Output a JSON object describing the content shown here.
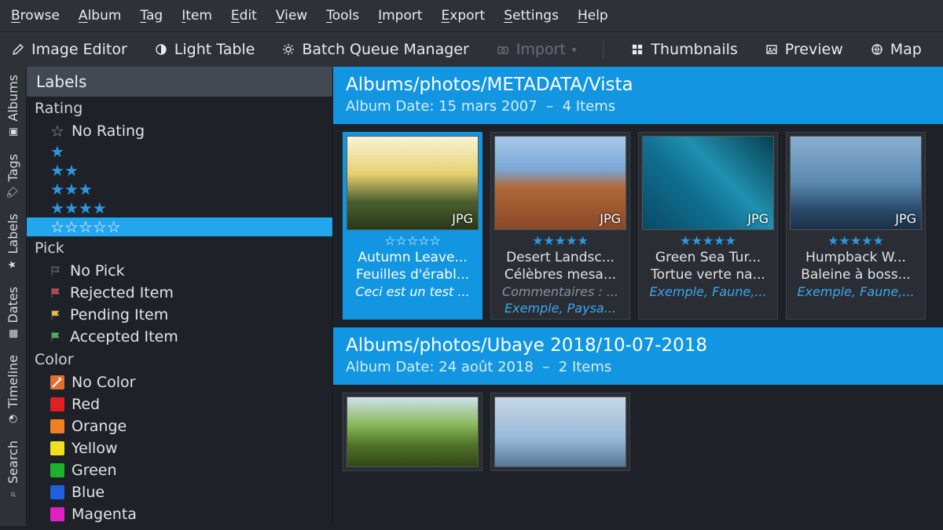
{
  "menu": [
    "Browse",
    "Album",
    "Tag",
    "Item",
    "Edit",
    "View",
    "Tools",
    "Import",
    "Export",
    "Settings",
    "Help"
  ],
  "toolbar": {
    "image_editor": "Image Editor",
    "light_table": "Light Table",
    "batch": "Batch Queue Manager",
    "import": "Import",
    "thumbnails": "Thumbnails",
    "preview": "Preview",
    "map": "Map"
  },
  "rail": [
    "Albums",
    "Tags",
    "Labels",
    "Dates",
    "Timeline",
    "Search"
  ],
  "sidebar": {
    "header": "Labels",
    "rating_label": "Rating",
    "no_rating": "No Rating",
    "selected_stars": 5,
    "pick_label": "Pick",
    "picks": [
      {
        "label": "No Pick",
        "color": "#2a2e34"
      },
      {
        "label": "Rejected Item",
        "color": "#e03040"
      },
      {
        "label": "Pending Item",
        "color": "#f0c030"
      },
      {
        "label": "Accepted Item",
        "color": "#30c050"
      }
    ],
    "color_label": "Color",
    "colors": [
      {
        "label": "No Color",
        "swatch": "#e07030",
        "icon": true
      },
      {
        "label": "Red",
        "swatch": "#e02020"
      },
      {
        "label": "Orange",
        "swatch": "#f08020"
      },
      {
        "label": "Yellow",
        "swatch": "#f0e020"
      },
      {
        "label": "Green",
        "swatch": "#20b030"
      },
      {
        "label": "Blue",
        "swatch": "#2060e0"
      },
      {
        "label": "Magenta",
        "swatch": "#e020c0"
      }
    ]
  },
  "albums": [
    {
      "path": "Albums/photos/METADATA/Vista",
      "date_label": "Album Date: 15 mars 2007",
      "count_label": "4 Items",
      "items": [
        {
          "sel": true,
          "img": "img1",
          "fmt": "JPG",
          "rating": 0,
          "title": "Autumn Leave...",
          "sub": "Feuilles d'érabl...",
          "sub2": "",
          "tags": "Ceci est un test ..."
        },
        {
          "sel": false,
          "img": "img2",
          "fmt": "JPG",
          "rating": 5,
          "title": "Desert Landsc...",
          "sub": "Célèbres mesa...",
          "sub2": "Commentaires : ...",
          "tags": "Exemple, Paysa..."
        },
        {
          "sel": false,
          "img": "img3",
          "fmt": "JPG",
          "rating": 5,
          "title": "Green Sea Tur...",
          "sub": "Tortue verte na...",
          "sub2": "",
          "tags": "Exemple, Faune,..."
        },
        {
          "sel": false,
          "img": "img4",
          "fmt": "JPG",
          "rating": 5,
          "title": "Humpback W...",
          "sub": "Baleine à boss...",
          "sub2": "",
          "tags": "Exemple, Faune,..."
        }
      ]
    },
    {
      "path": "Albums/photos/Ubaye 2018/10-07-2018",
      "date_label": "Album Date: 24 août 2018",
      "count_label": "2 Items",
      "items": [
        {
          "sel": false,
          "img": "img5",
          "fmt": "",
          "rating": 0,
          "title": "",
          "sub": "",
          "sub2": "",
          "tags": ""
        },
        {
          "sel": false,
          "img": "img6",
          "fmt": "",
          "rating": 0,
          "title": "",
          "sub": "",
          "sub2": "",
          "tags": ""
        }
      ]
    }
  ]
}
